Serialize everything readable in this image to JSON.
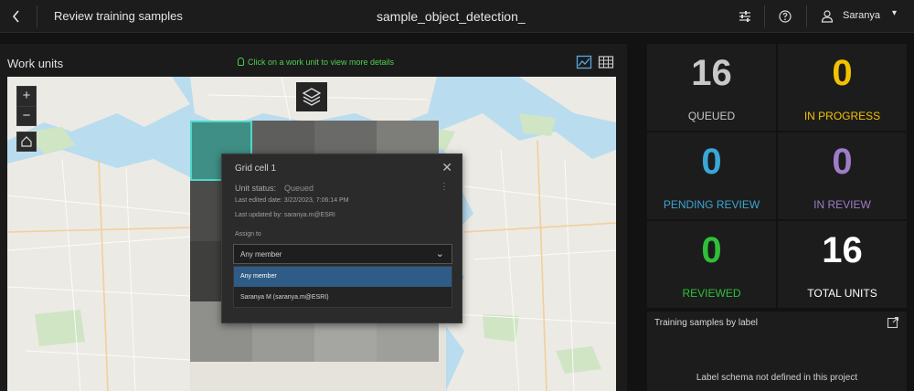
{
  "header": {
    "app_title": "Review training samples",
    "project_name": "sample_object_detection_",
    "user_name": "Saranya"
  },
  "work_units": {
    "title": "Work units",
    "hint": "Click on a work unit to view more details"
  },
  "popup": {
    "title": "Grid cell 1",
    "status_label": "Unit status:",
    "status_value": "Queued",
    "last_edited": "Last edited date: 3/22/2023, 7:06:14 PM",
    "last_updated": "Last updated by: saranya.m@ESRI",
    "assign_label": "Assign to",
    "assign_value": "Any member",
    "options": [
      "Any member",
      "Saranya M (saranya.m@ESRI)"
    ]
  },
  "stats": [
    {
      "value": "16",
      "label": "QUEUED",
      "color": "#c8c8c8"
    },
    {
      "value": "0",
      "label": "IN PROGRESS",
      "color": "#f2c200"
    },
    {
      "value": "0",
      "label": "PENDING REVIEW",
      "color": "#3aa6d6"
    },
    {
      "value": "0",
      "label": "IN REVIEW",
      "color": "#9e7cc8"
    },
    {
      "value": "0",
      "label": "REVIEWED",
      "color": "#2fbf3a"
    },
    {
      "value": "16",
      "label": "TOTAL UNITS",
      "color": "#ffffff"
    }
  ],
  "samples": {
    "title": "Training samples by label",
    "message": "Label schema not defined in this project"
  },
  "icons": {
    "back": "chevron-left-icon",
    "settings": "sliders-icon",
    "help": "help-icon",
    "user": "user-icon",
    "map_view": "map-view-icon",
    "table_view": "table-view-icon",
    "layers": "layers-icon",
    "home": "home-icon",
    "open": "open-external-icon"
  }
}
